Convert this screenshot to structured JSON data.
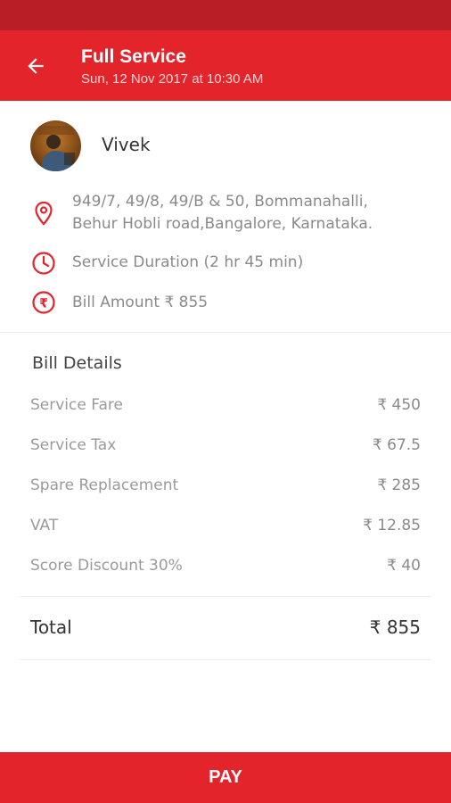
{
  "header": {
    "title": "Full Service",
    "subtitle": "Sun, 12 Nov 2017 at 10:30 AM"
  },
  "customer": {
    "name": "Vivek"
  },
  "info": {
    "address_line1": "949/7, 49/8, 49/B & 50, Bommanahalli,",
    "address_line2": "Behur Hobli road,Bangalore, Karnataka.",
    "duration": "Service Duration (2 hr 45 min)",
    "bill_amount": "Bill Amount ₹ 855"
  },
  "bill": {
    "title": "Bill Details",
    "rows": [
      {
        "label": "Service Fare",
        "value": "₹ 450"
      },
      {
        "label": "Service Tax",
        "value": "₹ 67.5"
      },
      {
        "label": "Spare Replacement",
        "value": "₹ 285"
      },
      {
        "label": "VAT",
        "value": "₹ 12.85"
      },
      {
        "label": "Score Discount 30%",
        "value": "₹ 40"
      }
    ],
    "total_label": "Total",
    "total_value": "₹ 855"
  },
  "pay": {
    "label": "PAY"
  },
  "colors": {
    "accent": "#e3242b",
    "status_bar": "#b81f24",
    "muted_text": "#9a9a9a"
  }
}
